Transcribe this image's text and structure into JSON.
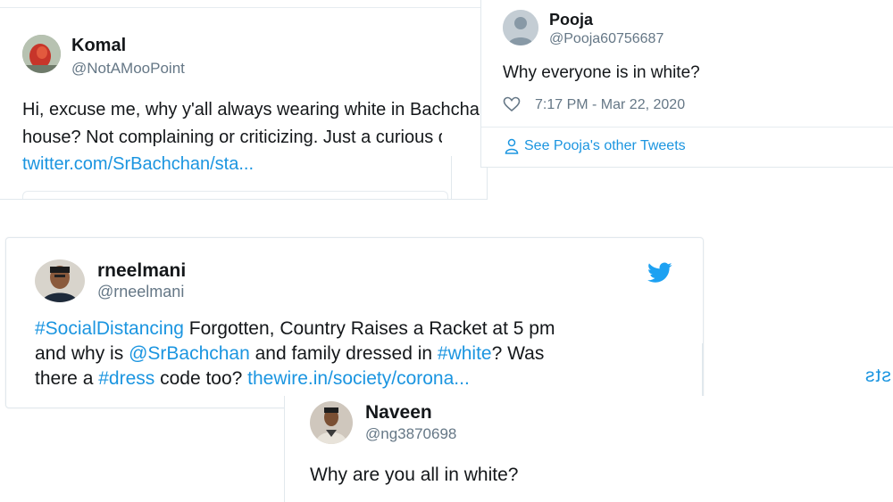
{
  "komal": {
    "name": "Komal",
    "handle": "@NotAMooPoint",
    "line1": "Hi, excuse me, why y'all always wearing white in Bachchan",
    "line2": "house? Not complaining or criticizing. Just a curious ques",
    "link": "twitter.com/SrBachchan/sta..."
  },
  "pooja": {
    "name": "Pooja",
    "handle": "@Pooja60756687",
    "text": "Why everyone is in white?",
    "timestamp": "7:17 PM - Mar 22, 2020",
    "other_tweets": "See Pooja's other Tweets"
  },
  "rneelmani": {
    "name": "rneelmani",
    "handle": "@rneelmani",
    "line1_tag": "#SocialDistancing",
    "line1_rest": " Forgotten, Country Raises a Racket at 5 pm",
    "line2_a": "and why is ",
    "line2_mention": "@SrBachchan",
    "line2_b": " and family dressed in ",
    "line2_tag": "#white",
    "line2_c": "? Was",
    "line3_a": "there a ",
    "line3_tag": "#dress",
    "line3_b": " code too?  ",
    "line3_link": "thewire.in/society/corona..."
  },
  "naveen": {
    "name": "Naveen",
    "handle": "@ng3870698",
    "text": "Why are you all in white?"
  },
  "partial": {
    "text": "sts"
  },
  "colors": {
    "link": "#1b95e0",
    "handle": "#657786",
    "text": "#14171a",
    "border": "#e1e8ed"
  },
  "icons": [
    "heart-icon",
    "person-icon",
    "twitter-bird-icon"
  ]
}
